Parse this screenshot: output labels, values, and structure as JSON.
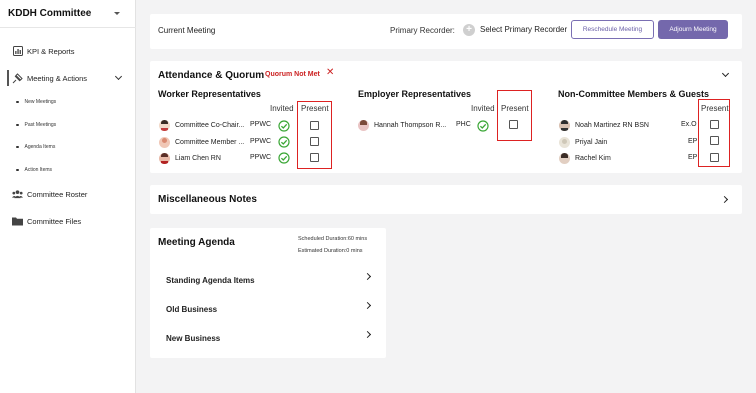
{
  "sidebar": {
    "team_name": "KDDH Committee",
    "items": [
      {
        "label": "KPI & Reports",
        "icon": "chart-icon"
      },
      {
        "label": "Meeting & Actions",
        "icon": "meeting-icon"
      },
      {
        "label": "Committee Roster",
        "icon": "people-icon"
      },
      {
        "label": "Committee Files",
        "icon": "folder-icon"
      }
    ],
    "sub_items": [
      {
        "label": "New Meetings"
      },
      {
        "label": "Past Meetings"
      },
      {
        "label": "Agenda Items"
      },
      {
        "label": "Action Items"
      }
    ]
  },
  "header": {
    "current_meeting": "Current Meeting",
    "primary_recorder_label": "Primary Recorder:",
    "select_recorder": "Select Primary Recorder",
    "reschedule_label": "Reschedule Meeting",
    "adjourn_label": "Adjourn Meeting"
  },
  "attendance": {
    "title": "Attendance & Quorum",
    "quorum_status": "Quorum Not Met",
    "quorum_color": "#cc2222",
    "invited_label": "Invited",
    "present_label": "Present",
    "worker": {
      "title": "Worker Representatives",
      "members": [
        {
          "name": "Committee Co-Chair...",
          "role": "PPWC",
          "invited": true,
          "present": false
        },
        {
          "name": "Committee Member ...",
          "role": "PPWC",
          "invited": true,
          "present": false
        },
        {
          "name": "Liam Chen RN",
          "role": "PPWC",
          "invited": true,
          "present": false
        }
      ]
    },
    "employer": {
      "title": "Employer Representatives",
      "members": [
        {
          "name": "Hannah Thompson R...",
          "role": "PHC",
          "invited": true,
          "present": false
        }
      ]
    },
    "guests": {
      "title": "Non-Committee Members & Guests",
      "members": [
        {
          "name": "Noah Martinez RN BSN",
          "role": "Ex.O",
          "present": false
        },
        {
          "name": "Priyal Jain",
          "role": "EP",
          "present": false
        },
        {
          "name": "Rachel Kim",
          "role": "EP",
          "present": false
        }
      ]
    }
  },
  "misc": {
    "title": "Miscellaneous Notes"
  },
  "agenda": {
    "title": "Meeting Agenda",
    "scheduled": "Scheduled Duration:60 mins",
    "estimated": "Estimated Duration:0 mins",
    "sections": [
      {
        "label": "Standing Agenda Items"
      },
      {
        "label": "Old Business"
      },
      {
        "label": "New Business"
      }
    ]
  },
  "colors": {
    "accent": "#7468ac",
    "check_green": "#3aa635",
    "highlight_red": "#dd2222"
  }
}
